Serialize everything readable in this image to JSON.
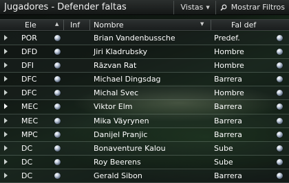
{
  "header": {
    "title": "Jugadores - Defender faltas",
    "views_label": "Vistas",
    "filters_label": "Mostrar Filtros"
  },
  "columns": {
    "pos": "Ele",
    "inf": "Inf",
    "name": "Nombre",
    "fal": "Fal def"
  },
  "rows": [
    {
      "pos": "POR",
      "name": "Brian Vandenbussche",
      "fal": "Predef."
    },
    {
      "pos": "DFD",
      "name": "Jiri Kladrubsky",
      "fal": "Hombre"
    },
    {
      "pos": "DFI",
      "name": "Răzvan Rat",
      "fal": "Hombre"
    },
    {
      "pos": "DFC",
      "name": "Michael Dingsdag",
      "fal": "Barrera"
    },
    {
      "pos": "DFC",
      "name": "Michal Svec",
      "fal": "Hombre"
    },
    {
      "pos": "MEC",
      "name": "Viktor Elm",
      "fal": "Barrera"
    },
    {
      "pos": "MEC",
      "name": "Mika Väyrynen",
      "fal": "Barrera"
    },
    {
      "pos": "MPC",
      "name": "Danijel Pranjic",
      "fal": "Barrera"
    },
    {
      "pos": "DC",
      "name": "Bonaventure Kalou",
      "fal": "Sube"
    },
    {
      "pos": "DC",
      "name": "Roy Beerens",
      "fal": "Sube"
    },
    {
      "pos": "DC",
      "name": "Gerald Sibon",
      "fal": "Barrera"
    }
  ],
  "icons": {
    "row_arrow": "play-arrow-icon",
    "row_menu": "orb-menu-icon",
    "filters": "search-icon",
    "views_caret": "chevron-down-icon"
  }
}
